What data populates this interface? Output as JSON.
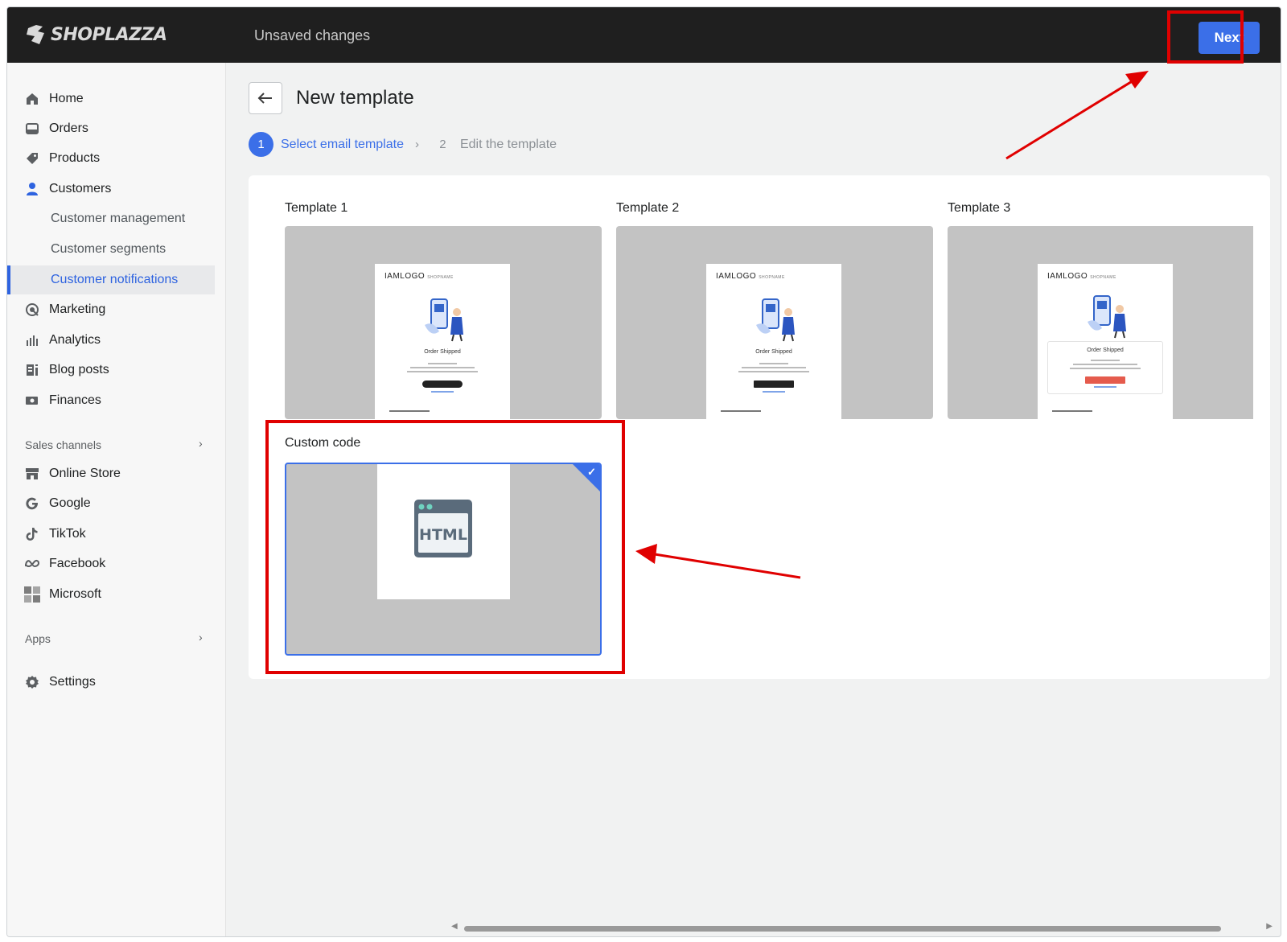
{
  "topbar": {
    "logo_text": "SHOPLAZZA",
    "status": "Unsaved changes",
    "next_label": "Next"
  },
  "sidebar": {
    "items": [
      {
        "label": "Home",
        "icon": "home-icon"
      },
      {
        "label": "Orders",
        "icon": "orders-icon"
      },
      {
        "label": "Products",
        "icon": "tag-icon"
      },
      {
        "label": "Customers",
        "icon": "person-icon"
      }
    ],
    "customer_sub": [
      {
        "label": "Customer management"
      },
      {
        "label": "Customer segments"
      },
      {
        "label": "Customer notifications",
        "active": true
      }
    ],
    "items2": [
      {
        "label": "Marketing",
        "icon": "marketing-icon"
      },
      {
        "label": "Analytics",
        "icon": "analytics-icon"
      },
      {
        "label": "Blog posts",
        "icon": "blog-icon"
      },
      {
        "label": "Finances",
        "icon": "finances-icon"
      }
    ],
    "sales_channels_label": "Sales channels",
    "channels": [
      {
        "label": "Online Store",
        "icon": "store-icon"
      },
      {
        "label": "Google",
        "icon": "google-icon"
      },
      {
        "label": "TikTok",
        "icon": "tiktok-icon"
      },
      {
        "label": "Facebook",
        "icon": "meta-icon"
      },
      {
        "label": "Microsoft",
        "icon": "microsoft-icon"
      }
    ],
    "apps_label": "Apps",
    "settings_label": "Settings"
  },
  "main": {
    "title": "New template",
    "steps": [
      {
        "num": "1",
        "label": "Select email template",
        "active": true
      },
      {
        "num": "2",
        "label": "Edit the template",
        "active": false
      }
    ],
    "templates": [
      {
        "label": "Template 1"
      },
      {
        "label": "Template 2"
      },
      {
        "label": "Template 3"
      }
    ],
    "template_preview": {
      "logo": "IAMLOGO",
      "logo_sub": "SHOPNAME",
      "heading": "Order Shipped"
    },
    "custom": {
      "label": "Custom code",
      "html_badge": "HTML",
      "selected": true
    }
  },
  "colors": {
    "accent": "#3b6fe8",
    "topbar": "#1f1f1f",
    "highlight": "#e00000"
  }
}
